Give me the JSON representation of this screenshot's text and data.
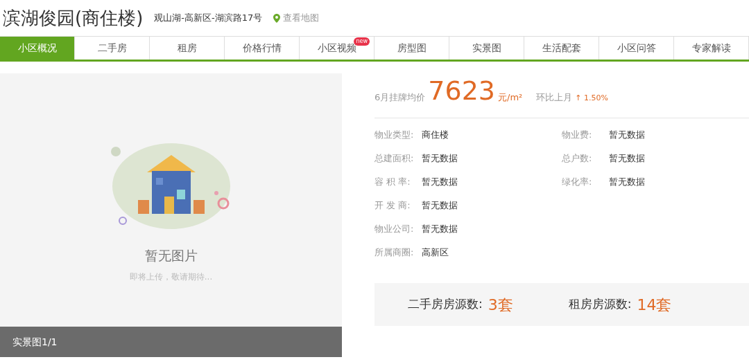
{
  "header": {
    "title": "滨湖俊园(商住楼)",
    "address": "观山湖-高新区-湖滨路17号",
    "map_link": "查看地图"
  },
  "tabs": [
    {
      "label": "小区概况",
      "selected": true
    },
    {
      "label": "二手房",
      "selected": false
    },
    {
      "label": "租房",
      "selected": false
    },
    {
      "label": "价格行情",
      "selected": false
    },
    {
      "label": "小区视频",
      "selected": false,
      "badge": "new"
    },
    {
      "label": "房型图",
      "selected": false
    },
    {
      "label": "实景图",
      "selected": false
    },
    {
      "label": "生活配套",
      "selected": false
    },
    {
      "label": "小区问答",
      "selected": false
    },
    {
      "label": "专家解读",
      "selected": false
    }
  ],
  "photo_panel": {
    "empty_title": "暂无图片",
    "empty_subtitle": "即将上传，敬请期待...",
    "caption": "实景图1/1"
  },
  "price": {
    "label": "6月挂牌均价",
    "value": "7623",
    "unit": "元/m²",
    "change_label": "环比上月",
    "change": "↑ 1.50%"
  },
  "details": [
    [
      {
        "label": "物业类型:",
        "value": "商住楼"
      },
      {
        "label": "物业费:",
        "value": "暂无数据"
      }
    ],
    [
      {
        "label": "总建面积:",
        "value": "暂无数据"
      },
      {
        "label": "总户数:",
        "value": "暂无数据"
      }
    ],
    [
      {
        "label": "容 积 率:",
        "value": "暂无数据"
      },
      {
        "label": "绿化率:",
        "value": "暂无数据"
      }
    ],
    [
      {
        "label": "开 发 商:",
        "value": "暂无数据"
      }
    ],
    [
      {
        "label": "物业公司:",
        "value": "暂无数据"
      }
    ],
    [
      {
        "label": "所属商圈:",
        "value": "高新区"
      }
    ]
  ],
  "listings": [
    {
      "label": "二手房房源数:",
      "value": "3套"
    },
    {
      "label": "租房房源数:",
      "value": "14套"
    }
  ]
}
